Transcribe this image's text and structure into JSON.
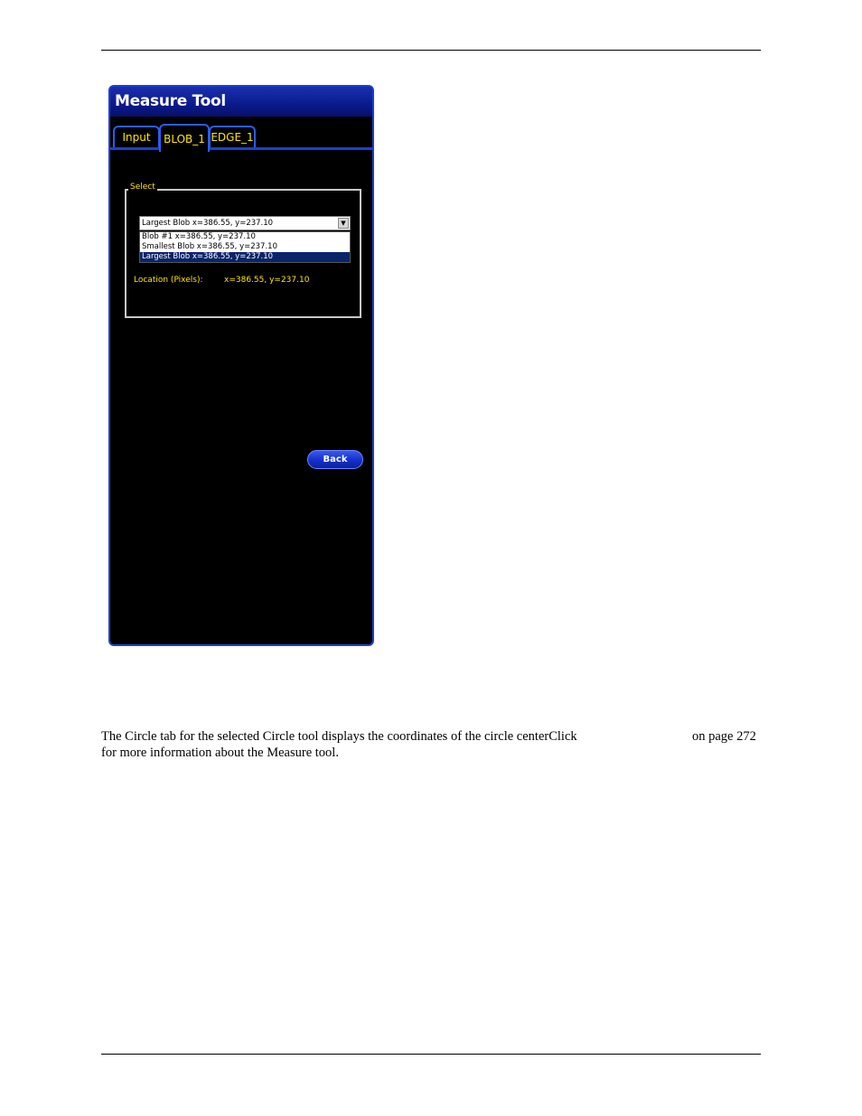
{
  "window": {
    "title": "Measure Tool",
    "tabs": [
      {
        "label": "Input"
      },
      {
        "label": "BLOB_1"
      },
      {
        "label": "EDGE_1"
      }
    ],
    "group_label": "Select",
    "combo_value": "Largest Blob   x=386.55, y=237.10",
    "options": [
      "Blob #1   x=386.55, y=237.10",
      "Smallest Blob   x=386.55, y=237.10",
      "Largest Blob   x=386.55, y=237.10"
    ],
    "location_label": "Location (Pixels):",
    "location_value": "x=386.55, y=237.10",
    "back_label": "Back",
    "colors": {
      "accent": "#1f3fd0",
      "label_text": "#ffe600",
      "selected_option": "#0a246a"
    }
  },
  "body": {
    "line1": "The Circle tab for the selected Circle tool displays the coordinates of the circle centerClick",
    "page_ref": "on page 272",
    "line2": "for more information about the Measure tool."
  }
}
